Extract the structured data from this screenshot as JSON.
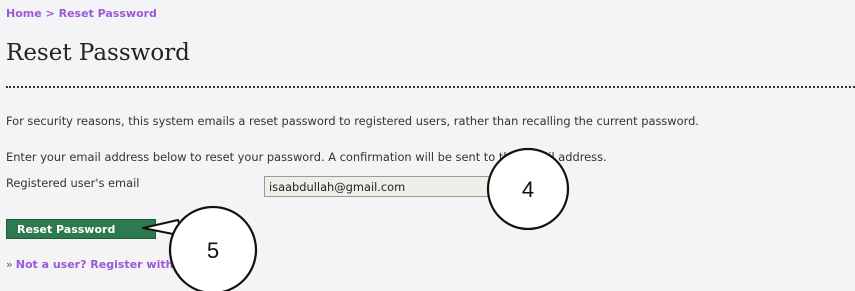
{
  "breadcrumb": {
    "home": "Home",
    "separator": ">",
    "current": "Reset Password"
  },
  "page_title": "Reset Password",
  "paragraphs": {
    "security_note": "For security reasons, this system emails a reset password to registered users, rather than recalling the current password.",
    "instructions": "Enter your email address below to reset your password. A confirmation will be sent to this email address."
  },
  "form": {
    "email_label": "Registered user's email",
    "email_value": "isaabdullah@gmail.com",
    "submit_label": "Reset Password"
  },
  "register_link": {
    "bullet": "»",
    "text": "Not a user? Register with this site"
  },
  "callouts": {
    "email_step": "4",
    "submit_step": "5"
  },
  "colors": {
    "background": "#f4f4f7",
    "link": "#9b59d6",
    "button": "#2e7a4f",
    "input_background": "#efefe9"
  }
}
